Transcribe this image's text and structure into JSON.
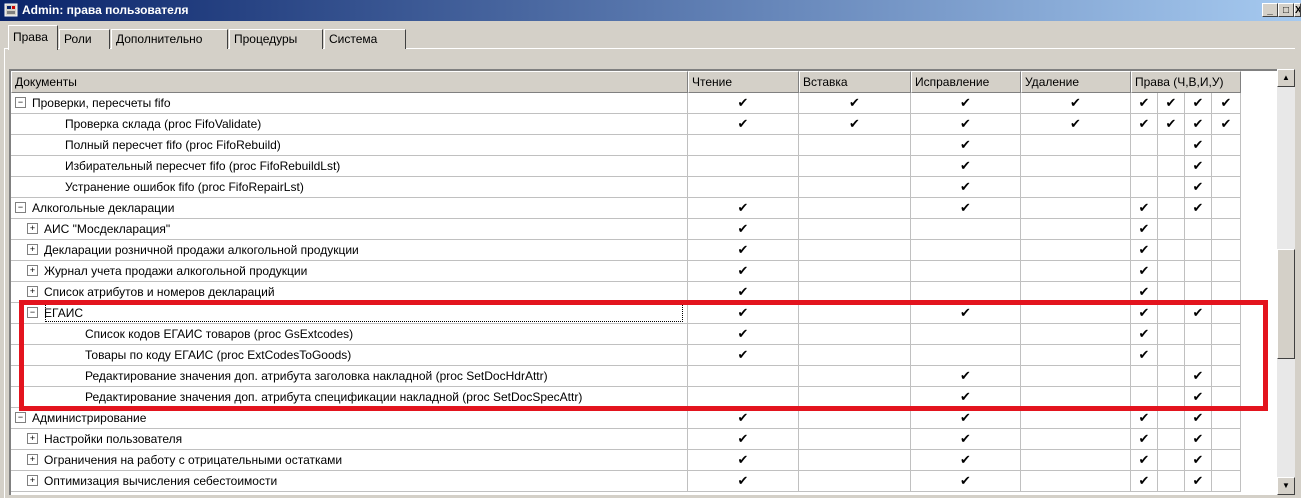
{
  "window": {
    "title": "Admin: права пользователя",
    "minimize": "_",
    "maximize": "□",
    "close": "X"
  },
  "tabs": [
    {
      "label": "Права",
      "active": true
    },
    {
      "label": "Роли",
      "active": false
    },
    {
      "label": "Дополнительно",
      "active": false
    },
    {
      "label": "Процедуры",
      "active": false
    },
    {
      "label": "Система",
      "active": false
    }
  ],
  "columns": [
    "Документы",
    "Чтение",
    "Вставка",
    "Исправление",
    "Удаление",
    "Права (Ч,В,И,У)"
  ],
  "check_glyph": "✔",
  "rows": [
    {
      "level": 0,
      "toggle": "−",
      "name": "Проверки, пересчеты fifo",
      "read": true,
      "insert": true,
      "edit": true,
      "delete": true,
      "rights": [
        true,
        true,
        true,
        true
      ]
    },
    {
      "level": 2,
      "toggle": "",
      "name": "Проверка склада (proc FifoValidate)",
      "read": true,
      "insert": true,
      "edit": true,
      "delete": true,
      "rights": [
        true,
        true,
        true,
        true
      ]
    },
    {
      "level": 2,
      "toggle": "",
      "name": "Полный пересчет fifo (proc FifoRebuild)",
      "read": false,
      "insert": false,
      "edit": true,
      "delete": false,
      "rights": [
        false,
        false,
        true,
        false
      ]
    },
    {
      "level": 2,
      "toggle": "",
      "name": "Избирательный пересчет fifo (proc FifoRebuildLst)",
      "read": false,
      "insert": false,
      "edit": true,
      "delete": false,
      "rights": [
        false,
        false,
        true,
        false
      ]
    },
    {
      "level": 2,
      "toggle": "",
      "name": "Устранение ошибок fifo (proc FifoRepairLst)",
      "read": false,
      "insert": false,
      "edit": true,
      "delete": false,
      "rights": [
        false,
        false,
        true,
        false
      ]
    },
    {
      "level": 0,
      "toggle": "−",
      "name": "Алкогольные декларации",
      "read": true,
      "insert": false,
      "edit": true,
      "delete": false,
      "rights": [
        true,
        false,
        true,
        false
      ]
    },
    {
      "level": 1,
      "toggle": "+",
      "name": "АИС \"Мосдекларация\"",
      "read": true,
      "insert": false,
      "edit": false,
      "delete": false,
      "rights": [
        true,
        false,
        false,
        false
      ]
    },
    {
      "level": 1,
      "toggle": "+",
      "name": "Декларации розничной продажи алкогольной продукции",
      "read": true,
      "insert": false,
      "edit": false,
      "delete": false,
      "rights": [
        true,
        false,
        false,
        false
      ]
    },
    {
      "level": 1,
      "toggle": "+",
      "name": "Журнал учета продажи алкогольной продукции",
      "read": true,
      "insert": false,
      "edit": false,
      "delete": false,
      "rights": [
        true,
        false,
        false,
        false
      ]
    },
    {
      "level": 1,
      "toggle": "+",
      "name": "Список атрибутов и номеров деклараций",
      "read": true,
      "insert": false,
      "edit": false,
      "delete": false,
      "rights": [
        true,
        false,
        false,
        false
      ]
    },
    {
      "level": 1,
      "toggle": "−",
      "name": "ЕГАИС",
      "read": true,
      "insert": false,
      "edit": true,
      "delete": false,
      "rights": [
        true,
        false,
        true,
        false
      ]
    },
    {
      "level": 3,
      "toggle": "",
      "name": "Список кодов ЕГАИС товаров (proc GsExtcodes)",
      "read": true,
      "insert": false,
      "edit": false,
      "delete": false,
      "rights": [
        true,
        false,
        false,
        false
      ]
    },
    {
      "level": 3,
      "toggle": "",
      "name": "Товары по коду ЕГАИС (proc ExtCodesToGoods)",
      "read": true,
      "insert": false,
      "edit": false,
      "delete": false,
      "rights": [
        true,
        false,
        false,
        false
      ]
    },
    {
      "level": 3,
      "toggle": "",
      "name": "Редактирование значения доп. атрибута заголовка накладной (proc SetDocHdrAttr)",
      "read": false,
      "insert": false,
      "edit": true,
      "delete": false,
      "rights": [
        false,
        false,
        true,
        false
      ]
    },
    {
      "level": 3,
      "toggle": "",
      "name": "Редактирование значения доп. атрибута спецификации накладной (proc SetDocSpecAttr)",
      "read": false,
      "insert": false,
      "edit": true,
      "delete": false,
      "rights": [
        false,
        false,
        true,
        false
      ]
    },
    {
      "level": 0,
      "toggle": "−",
      "name": "Администрирование",
      "read": true,
      "insert": false,
      "edit": true,
      "delete": false,
      "rights": [
        true,
        false,
        true,
        false
      ]
    },
    {
      "level": 1,
      "toggle": "+",
      "name": "Настройки пользователя",
      "read": true,
      "insert": false,
      "edit": true,
      "delete": false,
      "rights": [
        true,
        false,
        true,
        false
      ]
    },
    {
      "level": 1,
      "toggle": "+",
      "name": "Ограничения на работу с отрицательными остатками",
      "read": true,
      "insert": false,
      "edit": true,
      "delete": false,
      "rights": [
        true,
        false,
        true,
        false
      ]
    },
    {
      "level": 1,
      "toggle": "+",
      "name": "Оптимизация вычисления себестоимости",
      "read": true,
      "insert": false,
      "edit": true,
      "delete": false,
      "rights": [
        true,
        false,
        true,
        false
      ]
    }
  ],
  "scroll": {
    "up": "▲",
    "down": "▼"
  },
  "colors": {
    "highlight": "#e3141e",
    "titlebar": "#0a246a"
  }
}
